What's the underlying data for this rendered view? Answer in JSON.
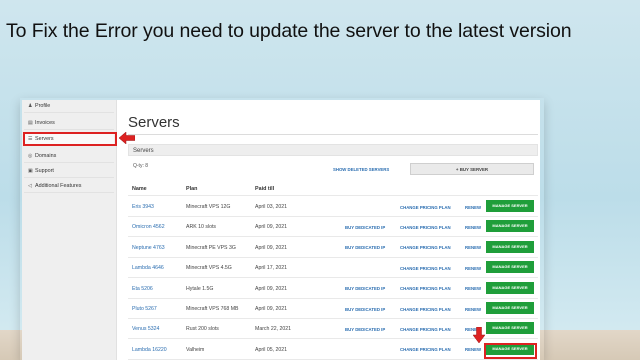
{
  "headline": "To Fix the Error you need to update the server to the latest version",
  "sidebar": {
    "items": [
      {
        "label": "Profile",
        "icon": "user-icon",
        "glyph": "♟"
      },
      {
        "label": "Invoices",
        "icon": "invoice-icon",
        "glyph": "▤"
      },
      {
        "label": "Servers",
        "icon": "server-icon",
        "glyph": "☰"
      },
      {
        "label": "Domains",
        "icon": "globe-icon",
        "glyph": "◎"
      },
      {
        "label": "Support",
        "icon": "support-icon",
        "glyph": "▣"
      },
      {
        "label": "Additional Features",
        "icon": "share-icon",
        "glyph": "◁"
      }
    ],
    "active": "Servers"
  },
  "main": {
    "title": "Servers",
    "panel_title": "Servers",
    "qty_label": "Q-ty: 8",
    "show_deleted": "SHOW DELETED SERVERS",
    "buy_server": "+ BUY SERVER",
    "columns": {
      "name": "Name",
      "plan": "Plan",
      "paid_till": "Paid till"
    }
  },
  "rows": [
    {
      "name": "Eris 3943",
      "plan": "Minecraft VPS 12G",
      "paid": "April 03, 2021",
      "dedicated": "",
      "change": "CHANGE PRICING PLAN",
      "renew": "RENEW",
      "manage": "MANAGE SERVER"
    },
    {
      "name": "Omicron 4562",
      "plan": "ARK 10 slots",
      "paid": "April 09, 2021",
      "dedicated": "BUY DEDICATED IP",
      "change": "CHANGE PRICING PLAN",
      "renew": "RENEW",
      "manage": "MANAGE SERVER"
    },
    {
      "name": "Neptune 4763",
      "plan": "Minecraft PE VPS 3G",
      "paid": "April 09, 2021",
      "dedicated": "BUY DEDICATED IP",
      "change": "CHANGE PRICING PLAN",
      "renew": "RENEW",
      "manage": "MANAGE SERVER"
    },
    {
      "name": "Lambda 4646",
      "plan": "Minecraft VPS 4.5G",
      "paid": "April 17, 2021",
      "dedicated": "",
      "change": "CHANGE PRICING PLAN",
      "renew": "RENEW",
      "manage": "MANAGE SERVER"
    },
    {
      "name": "Eta 5206",
      "plan": "Hytale 1.5G",
      "paid": "April 09, 2021",
      "dedicated": "BUY DEDICATED IP",
      "change": "CHANGE PRICING PLAN",
      "renew": "RENEW",
      "manage": "MANAGE SERVER"
    },
    {
      "name": "Pluto 5267",
      "plan": "Minecraft VPS 768 MB",
      "paid": "April 09, 2021",
      "dedicated": "BUY DEDICATED IP",
      "change": "CHANGE PRICING PLAN",
      "renew": "RENEW",
      "manage": "MANAGE SERVER"
    },
    {
      "name": "Venus 5324",
      "plan": "Rust 200 slots",
      "paid": "March 22, 2021",
      "dedicated": "BUY DEDICATED IP",
      "change": "CHANGE PRICING PLAN",
      "renew": "RENEW",
      "manage": "MANAGE SERVER"
    },
    {
      "name": "Lambda 16220",
      "plan": "Valheim",
      "paid": "April 05, 2021",
      "dedicated": "",
      "change": "CHANGE PRICING PLAN",
      "renew": "RENEW",
      "manage": "MANAGE SERVER"
    }
  ],
  "colors": {
    "accent_red": "#dd2222",
    "manage_green": "#1f9e3a",
    "link_blue": "#2a6db0"
  }
}
